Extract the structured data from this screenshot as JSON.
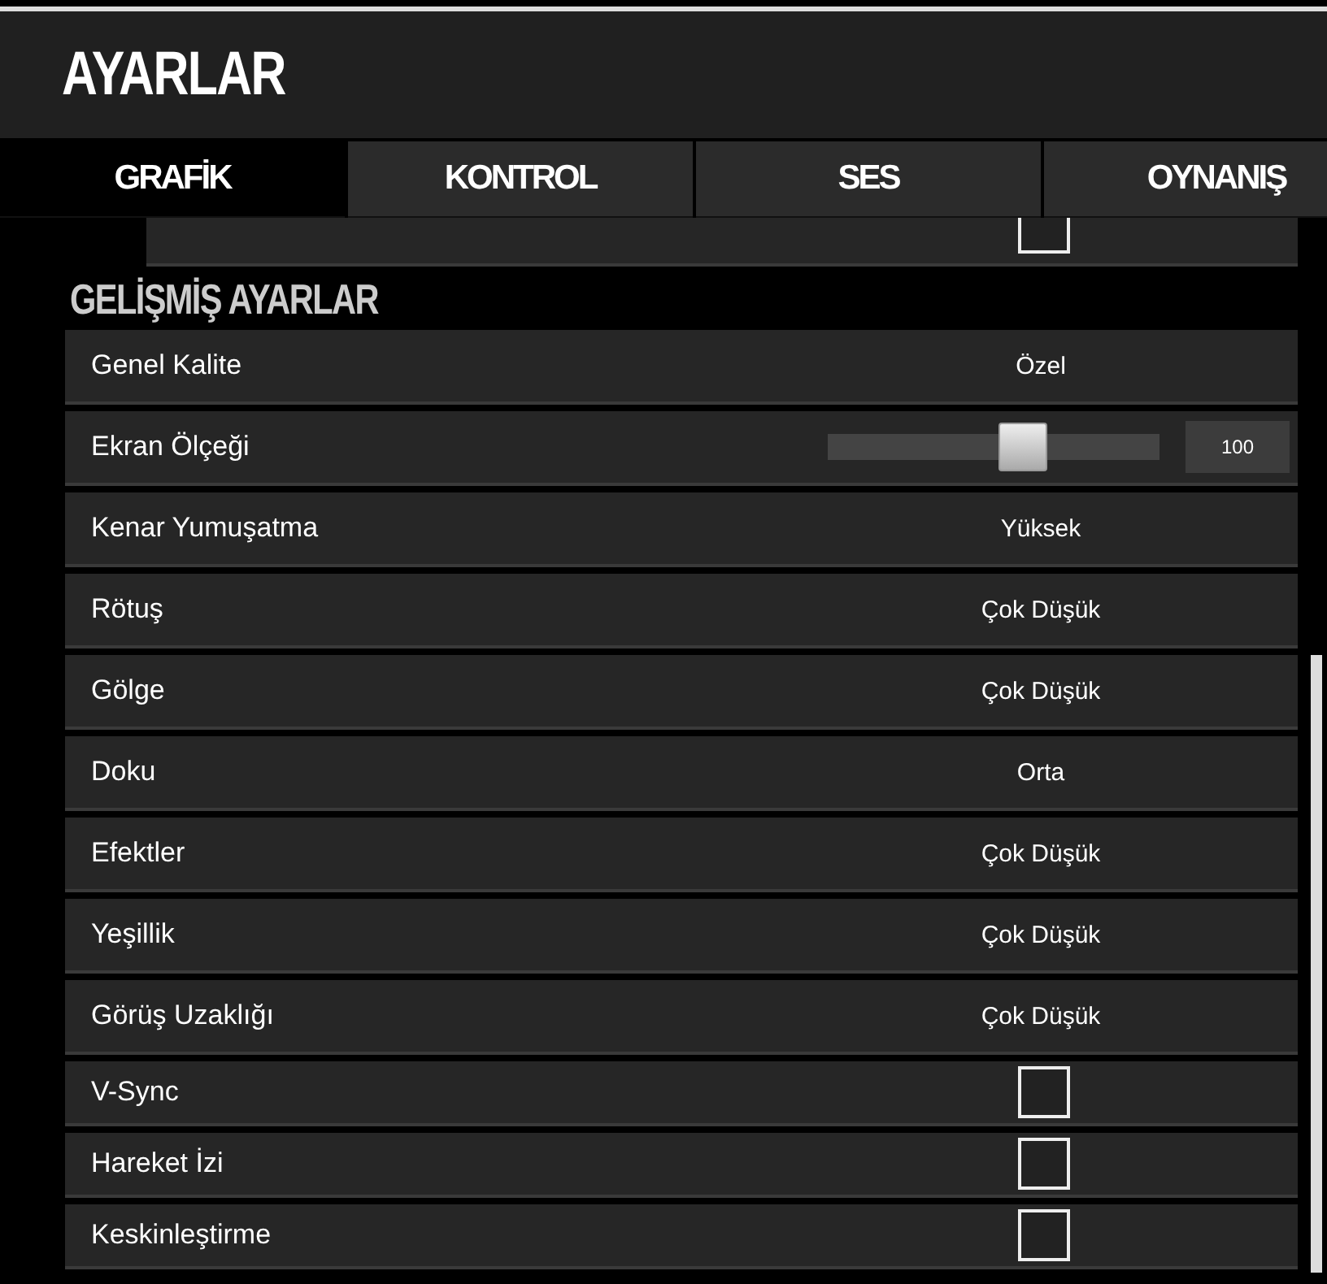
{
  "window": {
    "title": "AYARLAR"
  },
  "tabs": [
    {
      "label": "GRAFİK",
      "selected": true
    },
    {
      "label": "KONTROL",
      "selected": false
    },
    {
      "label": "SES",
      "selected": false
    },
    {
      "label": "OYNANIŞ",
      "selected": false
    }
  ],
  "partial_row": {
    "checked": false
  },
  "section": {
    "title": "GELİŞMİŞ AYARLAR"
  },
  "settings": [
    {
      "kind": "value",
      "label": "Genel Kalite",
      "value": "Özel"
    },
    {
      "kind": "slider",
      "label": "Ekran Ölçeği",
      "level": 0.59,
      "value": "100"
    },
    {
      "kind": "value",
      "label": "Kenar Yumuşatma",
      "value": "Yüksek"
    },
    {
      "kind": "value",
      "label": "Rötuş",
      "value": "Çok Düşük"
    },
    {
      "kind": "value",
      "label": "Gölge",
      "value": "Çok Düşük"
    },
    {
      "kind": "value",
      "label": "Doku",
      "value": "Orta"
    },
    {
      "kind": "value",
      "label": "Efektler",
      "value": "Çok Düşük"
    },
    {
      "kind": "value",
      "label": "Yeşillik",
      "value": "Çok Düşük"
    },
    {
      "kind": "value",
      "label": "Görüş Uzaklığı",
      "value": "Çok Düşük"
    },
    {
      "kind": "checkbox",
      "label": "V-Sync",
      "checked": false
    },
    {
      "kind": "checkbox",
      "label": "Hareket İzi",
      "checked": false
    },
    {
      "kind": "checkbox",
      "label": "Keskinleştirme",
      "checked": false
    }
  ]
}
